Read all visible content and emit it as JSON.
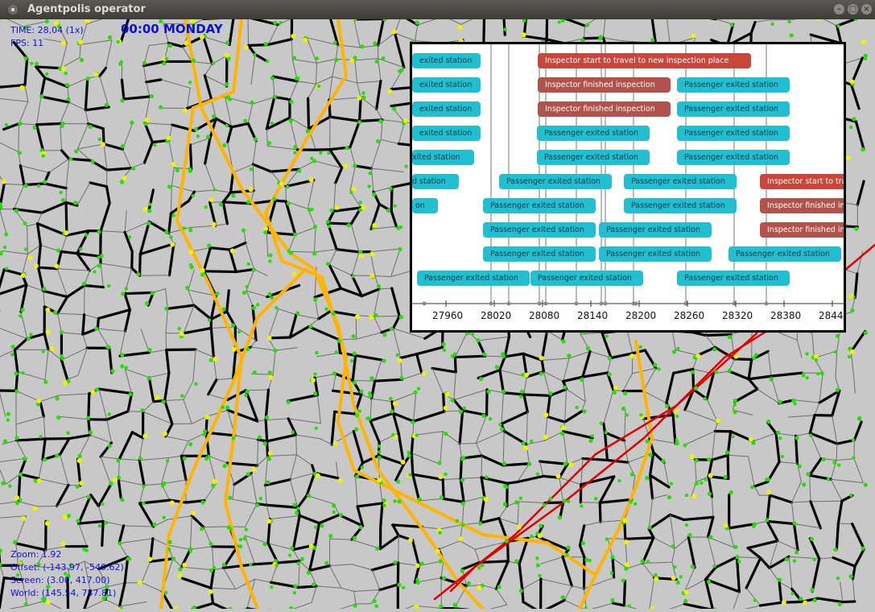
{
  "window": {
    "title": "Agentpolis operator"
  },
  "hud": {
    "time_label": "TIME: 28,04 (1x)",
    "fps_label": "FPS: 11",
    "clock": "00:00 MONDAY",
    "zoom": "Zoom: 1.92",
    "offset": "Offset: (-143.97, -540.62)",
    "screen": "Screen: (3.00, 417.00)",
    "world": "World: (145.54, 757.81)"
  },
  "timeline": {
    "axis_ticks": [
      "27960",
      "28020",
      "28080",
      "28140",
      "28200",
      "28260",
      "28320",
      "28380",
      "28440"
    ],
    "events": [
      {
        "label": "exited station",
        "kind": "pass"
      },
      {
        "label": "Inspector start to travel to new inspection place",
        "kind": "insp"
      },
      {
        "label": "exited station",
        "kind": "pass"
      },
      {
        "label": "Inspector finished inspection",
        "kind": "insp2"
      },
      {
        "label": "Passenger exited station",
        "kind": "pass"
      },
      {
        "label": "exited station",
        "kind": "pass"
      },
      {
        "label": "Inspector finished inspection",
        "kind": "insp2"
      },
      {
        "label": "Passenger exited station",
        "kind": "pass"
      },
      {
        "label": "exited station",
        "kind": "pass"
      },
      {
        "label": "Passenger exited station",
        "kind": "pass"
      },
      {
        "label": "Passenger exited station",
        "kind": "pass"
      },
      {
        "label": "xited station",
        "kind": "pass"
      },
      {
        "label": "Passenger exited station",
        "kind": "pass"
      },
      {
        "label": "Passenger exited station",
        "kind": "pass"
      },
      {
        "label": "d station",
        "kind": "pass"
      },
      {
        "label": "Passenger exited station",
        "kind": "pass"
      },
      {
        "label": "Passenger exited station",
        "kind": "pass"
      },
      {
        "label": "Inspector start to trav",
        "kind": "insp"
      },
      {
        "label": "on",
        "kind": "pass"
      },
      {
        "label": "Passenger exited station",
        "kind": "pass"
      },
      {
        "label": "Passenger exited station",
        "kind": "pass"
      },
      {
        "label": "Inspector finished in",
        "kind": "insp2"
      },
      {
        "label": "Passenger exited station",
        "kind": "pass"
      },
      {
        "label": "Passenger exited station",
        "kind": "pass"
      },
      {
        "label": "Inspector finished in",
        "kind": "insp2"
      },
      {
        "label": "Passenger exited station",
        "kind": "pass"
      },
      {
        "label": "Passenger exited station",
        "kind": "pass"
      },
      {
        "label": "Passenger exited station",
        "kind": "pass"
      },
      {
        "label": "Passenger exited station",
        "kind": "pass"
      },
      {
        "label": "Passenger exited station",
        "kind": "pass"
      },
      {
        "label": "Passenger exited station",
        "kind": "pass"
      }
    ]
  },
  "colors": {
    "road_major": "#000000",
    "road_minor": "#6e6e6e",
    "route_orange": "#ffb400",
    "route_red": "#e00000",
    "node_green": "#22e000",
    "node_yellow": "#f4f000"
  }
}
